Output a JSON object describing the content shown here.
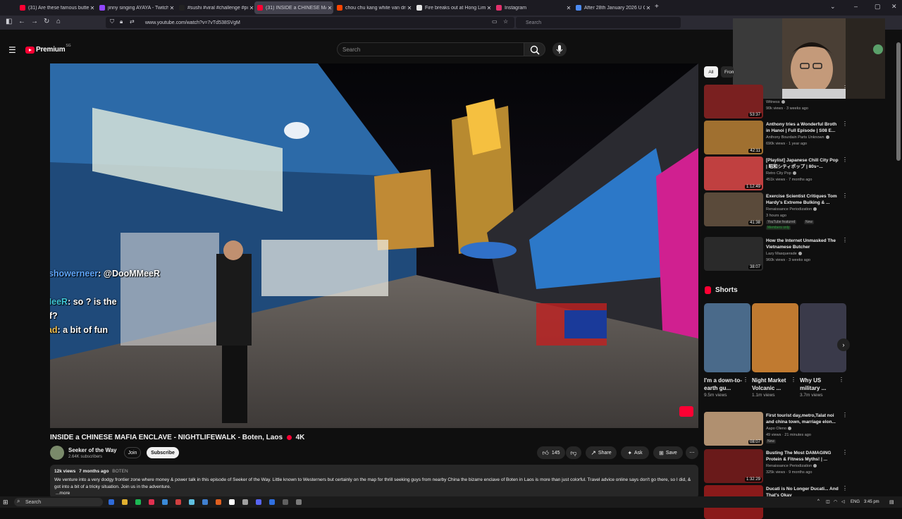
{
  "browser": {
    "tabs": [
      {
        "title": "(31) Are these famous butter c...",
        "favicon_color": "#ff0033"
      },
      {
        "title": "jinny singing AYAYA - Twitch",
        "favicon_color": "#9146ff"
      },
      {
        "title": "#sushi #viral #challenge #puzzl...",
        "favicon_color": "#222222"
      },
      {
        "title": "(31) INSIDE a CHINESE MA...",
        "favicon_color": "#ff0033",
        "active": true
      },
      {
        "title": "chou chu kang white van driver...",
        "favicon_color": "#ff4500"
      },
      {
        "title": "Fire breaks out at Hong Lim fo...",
        "favicon_color": "#e5e5e5"
      },
      {
        "title": "Instagram",
        "favicon_color": "#e1306c"
      },
      {
        "title": "After 28th January 2026 U Can'...",
        "favicon_color": "#4c8bf5"
      }
    ],
    "new_tab_label": "+",
    "url": "www.youtube.com/watch?v=7vTd538SVgM",
    "search_placeholder": "Search"
  },
  "youtube": {
    "logo_text": "Premium",
    "logo_region": "SG",
    "search_placeholder": "Search"
  },
  "video": {
    "title": "INSIDE a CHINESE MAFIA ENCLAVE - NIGHTLIFEWALK - Boten, Laos",
    "title_suffix": "4K",
    "channel": "Seeker of the Way",
    "subscribers": "2.64K subscribers",
    "join_label": "Join",
    "subscribe_label": "Subscribe",
    "likes": "145",
    "share_label": "Share",
    "ask_label": "Ask",
    "save_label": "Save",
    "views": "12k views",
    "age": "7 months ago",
    "location_tag": "BOTEN",
    "description": "We venture into a very dodgy frontier zone where money & power talk in this episode of Seeker of the Way. Little known to Westerners but certainly on the map for thrill seeking guys from nearby China the bizarre enclave of Boten in Laos is more than just colorful. Travel advice online says don't go there, so I did, & got into a bit of a tricky situation. Join us in the adventure.",
    "more_label": "...more"
  },
  "chat": [
    {
      "user": "goldenshowerneer",
      "text": ": @DooMMeeR"
    },
    {
      "user": "DooMMeeR",
      "text": ": so    ? is the"
    },
    {
      "user": "",
      "text": "dodgy stuff?"
    },
    {
      "user": "radenrad",
      "text": ": a bit of fun"
    }
  ],
  "sidebar": {
    "chips": [
      "All",
      "From"
    ],
    "recommendations": [
      {
        "title": "",
        "channel": "Witness",
        "views": "90k views · 3 weeks ago",
        "duration": "53:37",
        "thumb": "#7a2020"
      },
      {
        "title": "Anthony tries a Wonderful Broth in Hanoi | Full Episode | S08 E...",
        "channel": "Anthony Bourdain Parts Unknown",
        "views": "690k views · 1 year ago",
        "duration": "42:11",
        "thumb": "#a07030"
      },
      {
        "title": "[Playlist] Japanese Chill City Pop | 昭和シティポップ | 80s~...",
        "channel": "Retro City Pop",
        "views": "451k views · 7 months ago",
        "duration": "1:12:49",
        "thumb": "#c04040"
      },
      {
        "title": "Exercise Scientist Critiques Tom Hardy's Extreme Bulking & ...",
        "channel": "Renaissance Periodization",
        "views": "3 hours ago",
        "duration": "41:38",
        "thumb": "#5a4a3a",
        "badge": "YouTube featured",
        "badge2": "New",
        "members": "Members only"
      },
      {
        "title": "How the Internet Unmasked The Vietnamese Butcher",
        "channel": "Lazy Masquerade",
        "views": "960k views · 3 weeks ago",
        "duration": "38:07",
        "thumb": "#2a2a2a"
      }
    ],
    "shorts_heading": "Shorts",
    "shorts": [
      {
        "title": "I'm a down-to-earth gu...",
        "views": "9.5m views",
        "thumb": "#4a6a8a"
      },
      {
        "title": "Night Market Volcanic ...",
        "views": "1.1m views",
        "thumb": "#c07a30"
      },
      {
        "title": "Why US military ...",
        "views": "3.7m views",
        "thumb": "#3a3a4a"
      }
    ],
    "more_recs": [
      {
        "title": "First tourist day,metro,Talat noi and china town, marriage elon...",
        "channel": "Aapo Oleno",
        "views": "49 views · 21 minutes ago",
        "duration": "08:07",
        "thumb": "#b09070",
        "badge": "New"
      },
      {
        "title": "Busting The Most DAMAGING Protein & Fitness Myths! | ...",
        "channel": "Renaissance Periodization",
        "views": "325k views · 9 months ago",
        "duration": "1:32:29",
        "thumb": "#6a1a1a"
      },
      {
        "title": "Ducati is No Longer Ducati... And That's Okay",
        "channel": "",
        "views": "",
        "duration": "",
        "thumb": "#8a1a1a"
      }
    ]
  },
  "taskbar": {
    "search_label": "Search",
    "lang": "ENG",
    "time": "3:45 pm"
  }
}
